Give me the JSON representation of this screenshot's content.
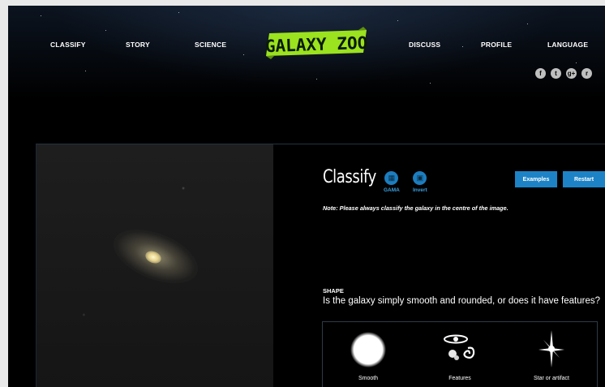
{
  "nav": {
    "left": [
      "CLASSIFY",
      "STORY",
      "SCIENCE"
    ],
    "right": [
      "DISCUSS",
      "PROFILE",
      "LANGUAGE"
    ],
    "logo_text": "GALAXY ZOO"
  },
  "social": [
    {
      "icon": "facebook-icon",
      "glyph": "f"
    },
    {
      "icon": "twitter-icon",
      "glyph": "t"
    },
    {
      "icon": "google-plus-icon",
      "glyph": "g+"
    },
    {
      "icon": "rss-icon",
      "glyph": "r"
    }
  ],
  "classify": {
    "title": "Classify",
    "tools": [
      {
        "label": "GAMA",
        "icon": "gama-icon"
      },
      {
        "label": "Invert",
        "icon": "invert-icon"
      }
    ],
    "buttons": {
      "examples": "Examples",
      "restart": "Restart"
    },
    "note": "Note: Please always classify the galaxy in the centre of the image.",
    "question_heading": "SHAPE",
    "question": "Is the galaxy simply smooth and rounded, or does it have features?",
    "answers": [
      {
        "label": "Smooth",
        "icon": "smooth-galaxy-icon"
      },
      {
        "label": "Features",
        "icon": "features-galaxy-icon"
      },
      {
        "label": "Star or artifact",
        "icon": "star-artifact-icon"
      }
    ]
  },
  "colors": {
    "accent": "#1d83c6",
    "logo_green": "#9be21f",
    "background": "#000000"
  }
}
